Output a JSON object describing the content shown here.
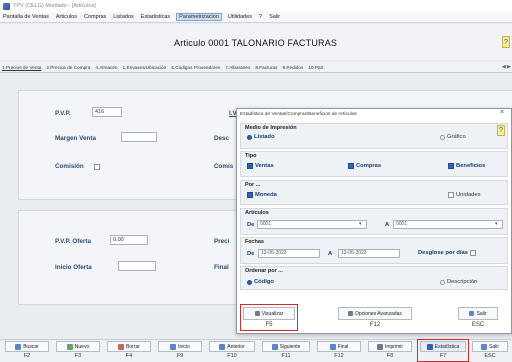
{
  "window": {
    "title": "TPV (CELG) Montado - [Articulos]"
  },
  "menu": [
    "Pantalla de Ventas",
    "Articulos",
    "Compras",
    "Listados",
    "Estadisticas",
    "Parametrizacion",
    "Utilidades",
    "?",
    "Salir"
  ],
  "header": {
    "title": "Articulo  0001  TALONARIO FACTURAS",
    "help": "?"
  },
  "tabs": [
    "1.Precios de Venta",
    "2.Precios de Compra",
    "4.Almacén",
    "1.Envases/Ubicación",
    "6.Códigos Proveedores",
    "7.Albaranes",
    "8.Facturas",
    "9.Pedidos",
    "10.Part."
  ],
  "tab_arrows": "◀ ▶",
  "form": {
    "pvp_label": "P.V.P.",
    "pvp_value": "416",
    "iva_label": "I.V.A.",
    "margen_label": "Margen Venta",
    "desc_label": "Desc",
    "comision_label": "Comisión",
    "comis_label": "Comis",
    "pvp_oferta_label": "P.V.P. Oferta",
    "pvp_oferta_value": "0.00",
    "precio_label": "Preci",
    "inicio_oferta_label": "Inicio Oferta",
    "final_label": "Final"
  },
  "dialog": {
    "title": "Estadística de Ventas/Compras/Beneficios de Artículos",
    "close": "×",
    "help": "?",
    "medio": {
      "title": "Medio de Impresión",
      "listado": "Listado",
      "grafico": "Gráfico"
    },
    "tipo": {
      "title": "Tipo",
      "ventas": "Ventas",
      "compras": "Compras",
      "beneficios": "Beneficios"
    },
    "por": {
      "title": "Por ...",
      "moneda": "Moneda",
      "unidades": "Unidades"
    },
    "articulos": {
      "title": "Artículos",
      "de_label": "De",
      "de_value": "0001",
      "a_label": "A",
      "a_value": "0001"
    },
    "fechas": {
      "title": "Fechas",
      "de_label": "De",
      "de_value": "13-06-2023",
      "a_label": "A",
      "a_value": "13-06-2023",
      "desglose": "Desglose por días"
    },
    "ordenar": {
      "title": "Ordenar por ...",
      "codigo": "Código",
      "descripcion": "Descripción"
    },
    "buttons": [
      {
        "label": "Visualizar",
        "key": "F5"
      },
      {
        "label": "Opciones Avanzadas",
        "key": "F12"
      },
      {
        "label": "Salir",
        "key": "ESC"
      }
    ]
  },
  "toolbar": [
    {
      "label": "Buscar",
      "key": "F2"
    },
    {
      "label": "Nuevo",
      "key": "F3"
    },
    {
      "label": "Borrar",
      "key": "F4"
    },
    {
      "label": "Inicio",
      "key": "F9"
    },
    {
      "label": "Anterior",
      "key": "F10"
    },
    {
      "label": "Siguiente",
      "key": "F11"
    },
    {
      "label": "Final",
      "key": "F12"
    },
    {
      "label": "Imprimir",
      "key": "F8"
    },
    {
      "label": "Estadística",
      "key": "F7"
    },
    {
      "label": "Salir",
      "key": "ESC"
    }
  ],
  "colors": {
    "accent": "#2f63b5",
    "highlight": "#d42a2a",
    "help": "#f4ec9c"
  }
}
